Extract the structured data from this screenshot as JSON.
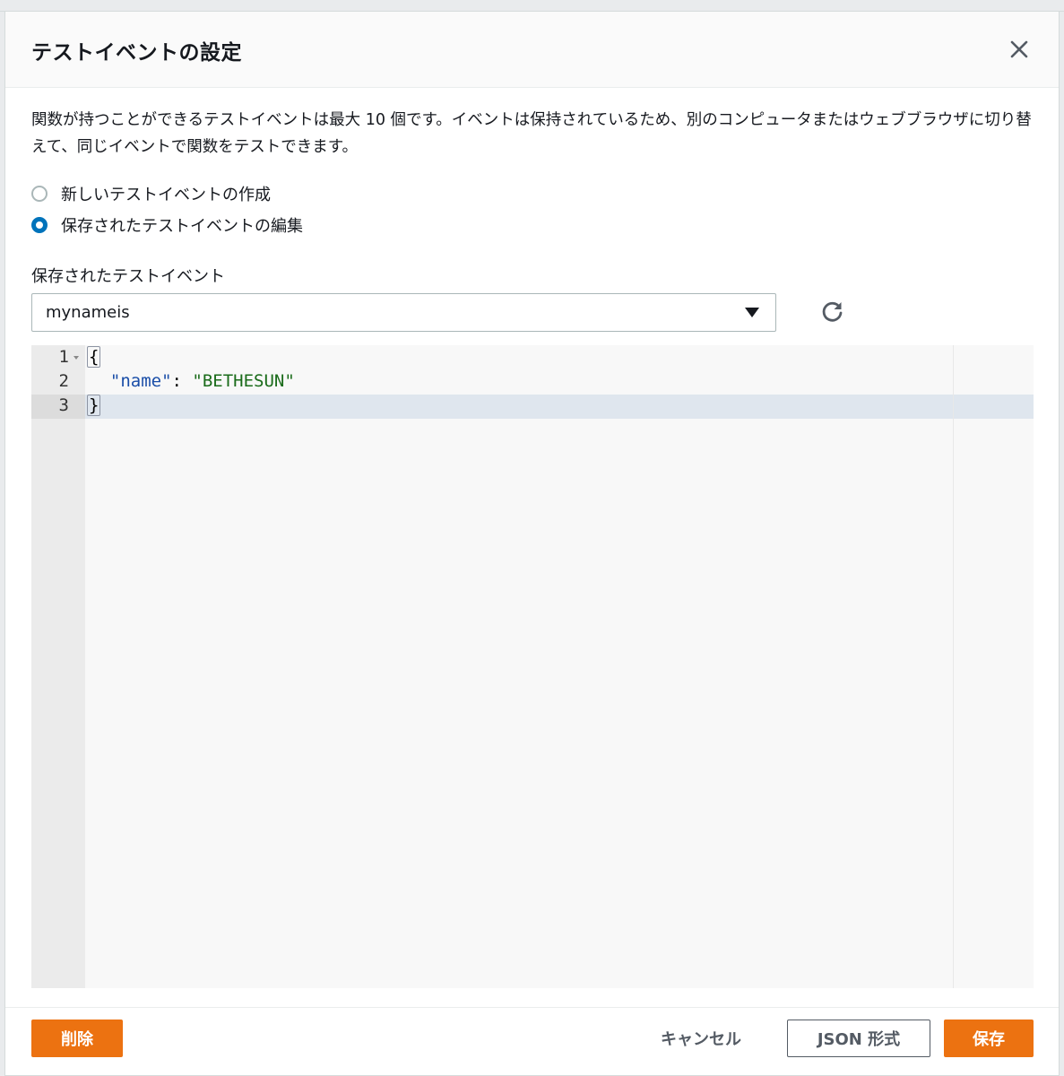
{
  "modal": {
    "title": "テストイベントの設定",
    "description": "関数が持つことができるテストイベントは最大 10 個です。イベントは保持されているため、別のコンピュータまたはウェブブラウザに切り替えて、同じイベントで関数をテストできます。",
    "options": [
      {
        "label": "新しいテストイベントの作成",
        "checked": false
      },
      {
        "label": "保存されたテストイベントの編集",
        "checked": true
      }
    ],
    "saved_event_label": "保存されたテストイベント",
    "selected_event": "mynameis",
    "editor": {
      "line_numbers": [
        "1",
        "2",
        "3"
      ],
      "lines": {
        "open": "{",
        "key": "\"name\"",
        "colon": ": ",
        "value": "\"BETHESUN\"",
        "close": "}"
      }
    },
    "buttons": {
      "delete": "削除",
      "cancel": "キャンセル",
      "format_json": "JSON 形式",
      "save": "保存"
    }
  },
  "colors": {
    "accent": "#ec7211",
    "radio_selected": "#0073bb"
  }
}
